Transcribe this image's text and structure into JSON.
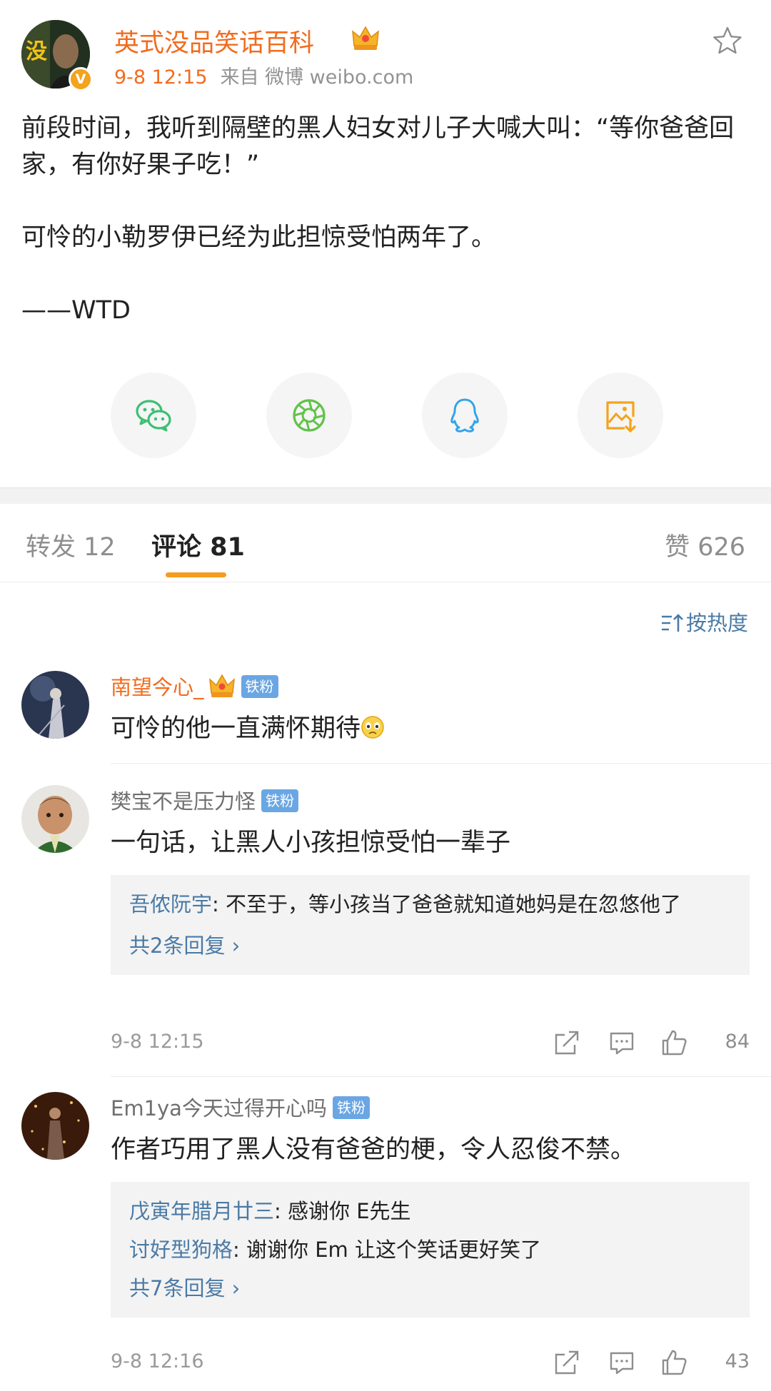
{
  "post": {
    "author": "英式没品笑话百科",
    "time": "9-8 12:15",
    "source": "来自 微博 weibo.com",
    "verified_label": "V",
    "paragraphs": [
      "前段时间，我听到隔壁的黑人妇女对儿子大喊大叫：“等你爸爸回家，有你好果子吃！”",
      "可怜的小勒罗伊已经为此担惊受怕两年了。",
      "——WTD"
    ]
  },
  "share": [
    "wechat-icon",
    "moments-icon",
    "qq-icon",
    "save-image-icon"
  ],
  "tabs": {
    "repost": "转发 12",
    "comment": "评论 81",
    "like": "赞 626"
  },
  "sort_label": "按热度",
  "colors": {
    "accent": "#f26b1d",
    "link": "#4a7aa6",
    "badge": "#6aa6e3",
    "tab_underline": "#f59b22"
  },
  "comments": [
    {
      "name": "南望今心_",
      "badge": "铁粉",
      "text": "可怜的他一直满怀期待"
    },
    {
      "name": "樊宝不是压力怪",
      "badge": "铁粉",
      "text": "一句话，让黑人小孩担惊受怕一辈子",
      "replies": [
        {
          "name": "吾侬阮宇",
          "text": ": 不至于，等小孩当了爸爸就知道她妈是在忽悠他了"
        }
      ],
      "more": "共2条回复 ›",
      "time": "9-8 12:15",
      "likes": "84"
    },
    {
      "name": "Em1ya今天过得开心吗",
      "badge": "铁粉",
      "text": "作者巧用了黑人没有爸爸的梗，令人忍俊不禁。",
      "replies": [
        {
          "name": "戊寅年腊月廿三",
          "text": ": 感谢你 E先生"
        },
        {
          "name": "讨好型狗格",
          "text": ": 谢谢你  Em  让这个笑话更好笑了"
        }
      ],
      "more": "共7条回复 ›",
      "time": "9-8 12:16",
      "likes": "43"
    }
  ]
}
